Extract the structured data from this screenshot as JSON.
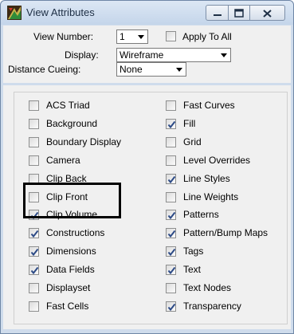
{
  "window": {
    "title": "View Attributes",
    "controls": [
      "minimize",
      "maximize",
      "close"
    ]
  },
  "top": {
    "view_number_label": "View Number:",
    "view_number_value": "1",
    "apply_to_all_label": "Apply To All",
    "apply_to_all_checked": false,
    "display_label": "Display:",
    "display_value": "Wireframe",
    "distance_cueing_label": "Distance Cueing:",
    "distance_cueing_value": "None"
  },
  "attributes": {
    "left": [
      {
        "label": "ACS Triad",
        "checked": false
      },
      {
        "label": "Background",
        "checked": false
      },
      {
        "label": "Boundary Display",
        "checked": false
      },
      {
        "label": "Camera",
        "checked": false
      },
      {
        "label": "Clip Back",
        "checked": false
      },
      {
        "label": "Clip Front",
        "checked": false
      },
      {
        "label": "Clip Volume",
        "checked": true
      },
      {
        "label": "Constructions",
        "checked": true
      },
      {
        "label": "Dimensions",
        "checked": true
      },
      {
        "label": "Data Fields",
        "checked": true
      },
      {
        "label": "Displayset",
        "checked": false
      },
      {
        "label": "Fast Cells",
        "checked": false
      }
    ],
    "right": [
      {
        "label": "Fast Curves",
        "checked": false
      },
      {
        "label": "Fill",
        "checked": true
      },
      {
        "label": "Grid",
        "checked": false
      },
      {
        "label": "Level Overrides",
        "checked": false
      },
      {
        "label": "Line Styles",
        "checked": true
      },
      {
        "label": "Line Weights",
        "checked": false
      },
      {
        "label": "Patterns",
        "checked": true
      },
      {
        "label": "Pattern/Bump Maps",
        "checked": true
      },
      {
        "label": "Tags",
        "checked": true
      },
      {
        "label": "Text",
        "checked": true
      },
      {
        "label": "Text Nodes",
        "checked": false
      },
      {
        "label": "Transparency",
        "checked": true
      }
    ]
  },
  "colors": {
    "check_mark": "#2c4a86",
    "highlight_box": "#000000",
    "title_bar": "#c4d5ea"
  }
}
